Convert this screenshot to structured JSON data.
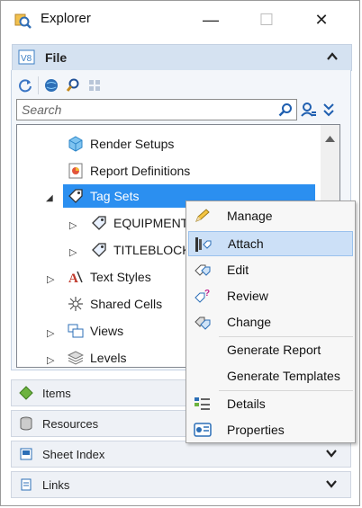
{
  "window": {
    "title": "Explorer",
    "minimize_glyph": "—",
    "maximize_glyph": "☐",
    "close_glyph": "✕"
  },
  "file_panel": {
    "title": "File",
    "icon": "v8-icon",
    "toolbar": [
      "refresh-icon",
      "globe-icon",
      "find-icon",
      "grid-icon"
    ],
    "search": {
      "placeholder": "Search",
      "value": ""
    },
    "tree": [
      {
        "label": "Render Setups",
        "icon": "cube-icon",
        "level": 2,
        "expander": "none"
      },
      {
        "label": "Report Definitions",
        "icon": "report-icon",
        "level": 2,
        "expander": "none"
      },
      {
        "label": "Tag Sets",
        "icon": "tag-icon",
        "level": 2,
        "expander": "expanded",
        "selected": true
      },
      {
        "label": "EQUIPMENT",
        "icon": "tag-icon",
        "level": 3,
        "expander": "collapsed"
      },
      {
        "label": "TITLEBLOCK",
        "icon": "tag-icon",
        "level": 3,
        "expander": "collapsed"
      },
      {
        "label": "Text Styles",
        "icon": "text-style-icon",
        "level": 1,
        "expander": "collapsed"
      },
      {
        "label": "Shared Cells",
        "icon": "shared-cells-icon",
        "level": 1,
        "expander": "none"
      },
      {
        "label": "Views",
        "icon": "views-icon",
        "level": 1,
        "expander": "collapsed"
      },
      {
        "label": "Levels",
        "icon": "levels-icon",
        "level": 1,
        "expander": "collapsed"
      }
    ]
  },
  "panels": [
    {
      "label": "Items",
      "icon": "items-icon"
    },
    {
      "label": "Resources",
      "icon": "resources-icon"
    },
    {
      "label": "Sheet Index",
      "icon": "sheet-index-icon"
    },
    {
      "label": "Links",
      "icon": "links-icon"
    }
  ],
  "context_menu": [
    {
      "label": "Manage",
      "icon": "pencil-icon"
    },
    {
      "label": "Attach",
      "icon": "attach-icon",
      "highlighted": true
    },
    {
      "label": "Edit",
      "icon": "edit-tag-icon"
    },
    {
      "label": "Review",
      "icon": "review-icon"
    },
    {
      "label": "Change",
      "icon": "change-icon"
    },
    {
      "label": "Generate Report",
      "icon": ""
    },
    {
      "label": "Generate Templates",
      "icon": ""
    },
    {
      "label": "Details",
      "icon": "details-icon"
    },
    {
      "label": "Properties",
      "icon": "properties-icon"
    }
  ],
  "colors": {
    "selection": "#2b8ff0",
    "menu_highlight": "#cce0f7",
    "panel_header": "#d5e2f1"
  }
}
